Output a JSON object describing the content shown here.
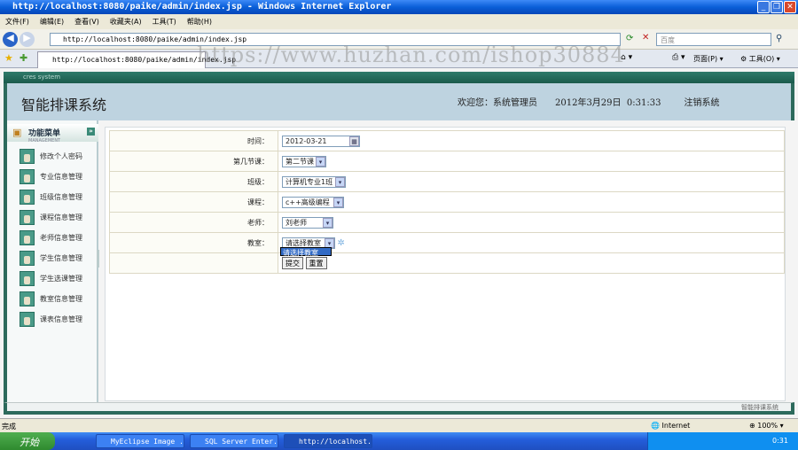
{
  "window": {
    "title": "http://localhost:8080/paike/admin/index.jsp - Windows Internet Explorer"
  },
  "menu": [
    "文件(F)",
    "编辑(E)",
    "查看(V)",
    "收藏夹(A)",
    "工具(T)",
    "帮助(H)"
  ],
  "address": {
    "url": "http://localhost:8080/paike/admin/index.jsp",
    "search_placeholder": "百度"
  },
  "tab": {
    "label": "http://localhost:8080/paike/admin/index.jsp"
  },
  "toolbar": {
    "page": "页面(P)",
    "tools": "工具(O)"
  },
  "watermark": "https://www.huzhan.com/ishop30884",
  "app": {
    "strip": "cres system",
    "title": "智能排课系统",
    "welcome": "欢迎您：系统管理员",
    "datetime": "2012年3月29日  0:31:33",
    "logout": "注销系统",
    "footer": "智能排课系统"
  },
  "sidebar": {
    "title": "功能菜单",
    "subtitle": "MANAGEMENT",
    "items": [
      "修改个人密码",
      "专业信息管理",
      "班级信息管理",
      "课程信息管理",
      "老师信息管理",
      "学生信息管理",
      "学生选课管理",
      "教室信息管理",
      "课表信息管理"
    ]
  },
  "form": {
    "date_label": "时间：",
    "date_value": "2012-03-21",
    "period_label": "第几节课：",
    "period_value": "第二节课",
    "class_label": "班级：",
    "class_value": "计算机专业1班",
    "course_label": "课程：",
    "course_value": "c++高级编程",
    "teacher_label": "老师：",
    "teacher_value": "刘老师",
    "room_label": "教室：",
    "room_value": "请选择教室",
    "room_option": "请选择教室",
    "submit": "提交",
    "reset": "重置"
  },
  "status": {
    "text": "完成",
    "zone": "Internet",
    "zoom": "100%"
  },
  "taskbar": {
    "start": "开始",
    "tasks": [
      "MyEclipse Image ...",
      "SQL Server Enter...",
      "http://localhost..."
    ],
    "clock": "0:31"
  }
}
